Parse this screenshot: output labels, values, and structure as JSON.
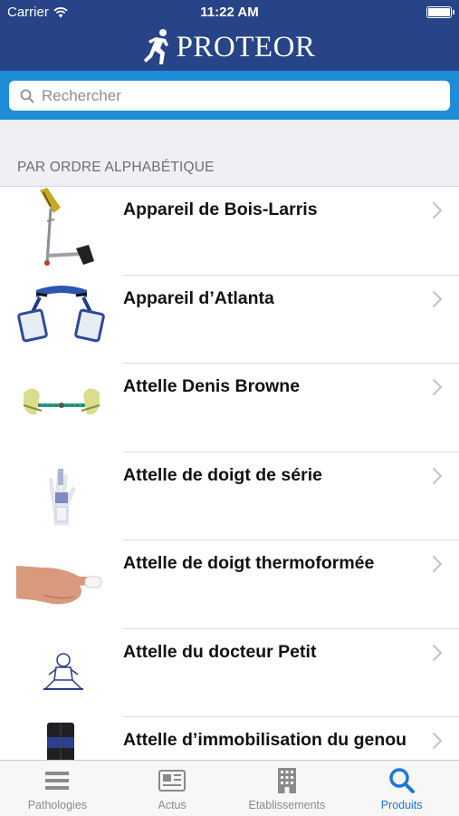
{
  "status_bar": {
    "carrier": "Carrier",
    "time": "11:22 AM"
  },
  "header": {
    "brand": "PROTEOR"
  },
  "search": {
    "placeholder": "Rechercher",
    "value": ""
  },
  "section": {
    "title": "PAR ORDRE ALPHABÉTIQUE"
  },
  "products": [
    {
      "name": "Appareil de Bois-Larris",
      "icon": "brace-leg-device-icon"
    },
    {
      "name": "Appareil d’Atlanta",
      "icon": "hip-abduction-brace-icon"
    },
    {
      "name": "Attelle Denis Browne",
      "icon": "denis-browne-bar-icon"
    },
    {
      "name": "Attelle de doigt de série",
      "icon": "finger-splint-icon"
    },
    {
      "name": "Attelle de doigt thermoformée",
      "icon": "hand-splint-icon"
    },
    {
      "name": "Attelle du docteur Petit",
      "icon": "child-diagram-icon"
    },
    {
      "name": "Attelle d’immobilisation du genou",
      "icon": "knee-immobilizer-icon"
    }
  ],
  "tabs": [
    {
      "label": "Pathologies",
      "icon": "list-icon",
      "active": false
    },
    {
      "label": "Actus",
      "icon": "newspaper-icon",
      "active": false
    },
    {
      "label": "Etablissements",
      "icon": "building-icon",
      "active": false
    },
    {
      "label": "Produits",
      "icon": "search-icon",
      "active": true
    }
  ],
  "colors": {
    "header_bg": "#264487",
    "search_bar_bg": "#1e8cd8",
    "section_bg": "#efeff4",
    "tab_active": "#1a78d6",
    "tab_inactive": "#8a8a8f"
  }
}
